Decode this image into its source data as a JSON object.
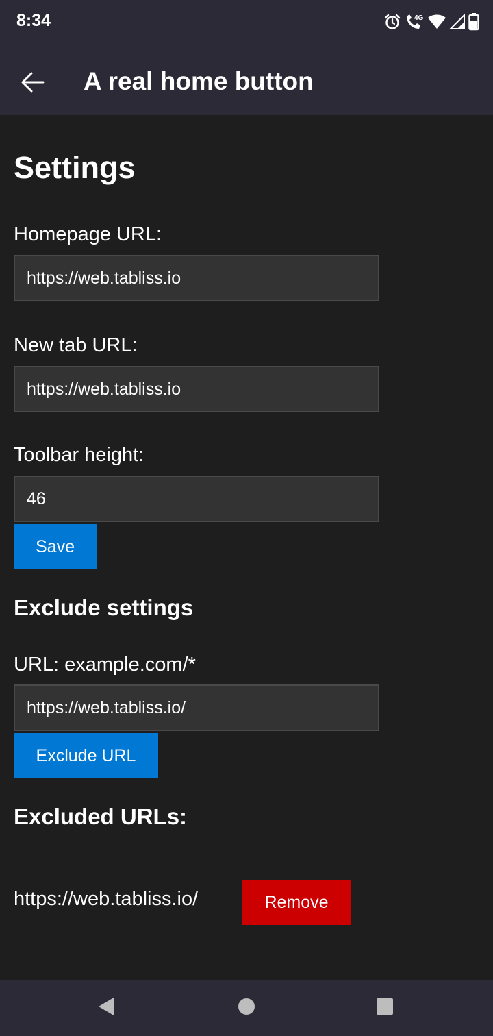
{
  "status_bar": {
    "time": "8:34",
    "icons": [
      "alarm-icon",
      "wifi-calling-4g-icon",
      "wifi-icon",
      "signal-icon",
      "battery-icon"
    ]
  },
  "app_bar": {
    "title": "A real home button",
    "back_icon": "arrow-back-icon"
  },
  "settings": {
    "heading": "Settings",
    "homepage_label": "Homepage URL:",
    "homepage_value": "https://web.tabliss.io",
    "newtab_label": "New tab URL:",
    "newtab_value": "https://web.tabliss.io",
    "toolbar_label": "Toolbar height:",
    "toolbar_value": "46",
    "save_label": "Save"
  },
  "exclude": {
    "heading": "Exclude settings",
    "url_label": "URL: example.com/*",
    "url_value": "https://web.tabliss.io/",
    "exclude_button_label": "Exclude URL"
  },
  "excluded": {
    "heading": "Excluded URLs:",
    "items": [
      {
        "url": "https://web.tabliss.io/",
        "remove_label": "Remove"
      }
    ]
  },
  "colors": {
    "background": "#1e1e1e",
    "bar": "#2b2a36",
    "input_bg": "#333333",
    "primary_button": "#0078d4",
    "danger_button": "#cc0000"
  },
  "nav_bar": {
    "icons": [
      "nav-back-icon",
      "nav-home-icon",
      "nav-recents-icon"
    ]
  }
}
